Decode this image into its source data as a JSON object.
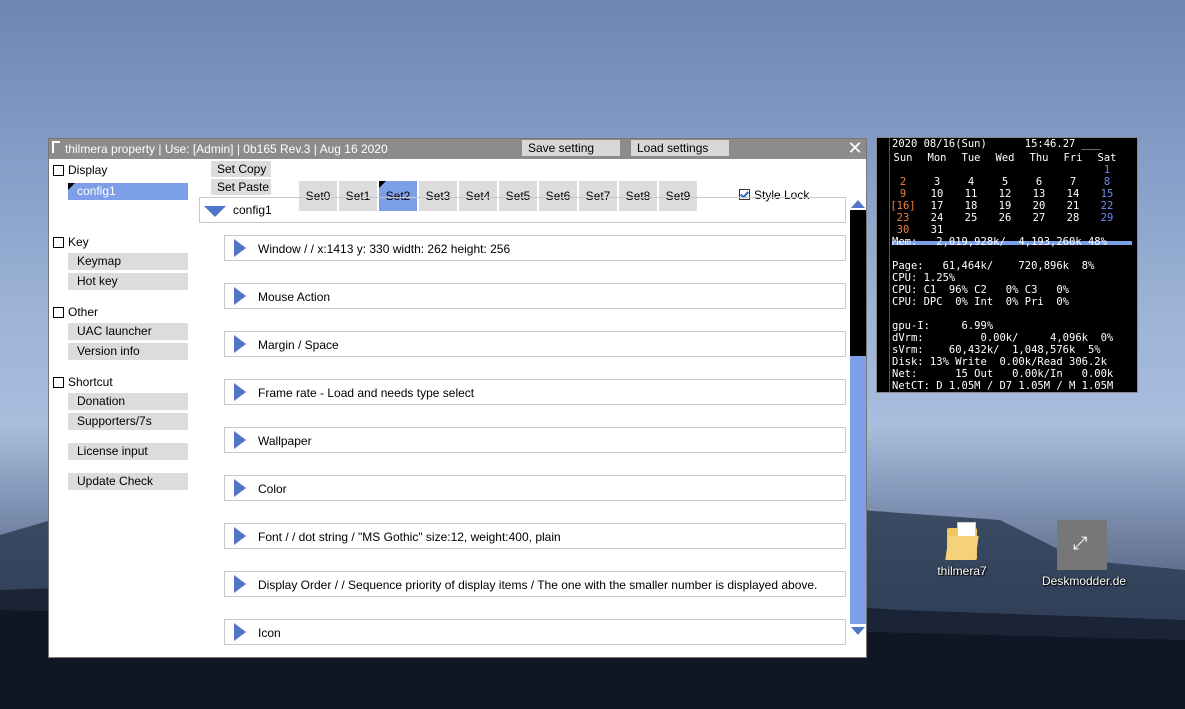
{
  "window": {
    "title": "thilmera property | Use: [Admin] | 0b165 Rev.3 | Aug 16 2020",
    "save_label": "Save setting",
    "load_label": "Load settings",
    "close": "✕"
  },
  "sidebar": {
    "display": {
      "label": "Display",
      "items": [
        "config1"
      ]
    },
    "key": {
      "label": "Key",
      "items": [
        "Keymap",
        "Hot key"
      ]
    },
    "other": {
      "label": "Other",
      "items": [
        "UAC launcher",
        "Version info"
      ]
    },
    "shortcut": {
      "label": "Shortcut",
      "items": [
        "Donation",
        "Supporters/7s",
        "License input",
        "Update Check"
      ]
    }
  },
  "toolbar": {
    "set_copy": "Set Copy",
    "set_paste": "Set Paste",
    "tabs": [
      "Set0",
      "Set1",
      "Set2",
      "Set3",
      "Set4",
      "Set5",
      "Set6",
      "Set7",
      "Set8",
      "Set9"
    ],
    "selected_tab": "Set2",
    "style_lock": "Style Lock",
    "style_lock_checked": true
  },
  "config": {
    "header": "config1",
    "sections": [
      "Window / / x:1413 y: 330 width: 262 height: 256",
      "Mouse Action",
      "Margin / Space",
      "Frame rate - Load and needs type select",
      "Wallpaper",
      "Color",
      "Font / / dot string / \"MS Gothic\" size:12, weight:400, plain",
      "Display Order / / Sequence priority of display items / The one with the smaller number is displayed above.",
      "Icon"
    ]
  },
  "widget": {
    "header_date": "2020 08/16(Sun)",
    "header_time": "15:46.27",
    "header_tail": "___",
    "weekdays": [
      "Sun",
      "Mon",
      "Tue",
      "Wed",
      "Thu",
      "Fri",
      "Sat"
    ],
    "calendar": [
      [
        "",
        "",
        "",
        "",
        "",
        "",
        "1"
      ],
      [
        "2",
        "3",
        "4",
        "5",
        "6",
        "7",
        "8"
      ],
      [
        "9",
        "10",
        "11",
        "12",
        "13",
        "14",
        "15"
      ],
      [
        "[16]",
        "17",
        "18",
        "19",
        "20",
        "21",
        "22"
      ],
      [
        "23",
        "24",
        "25",
        "26",
        "27",
        "28",
        "29"
      ],
      [
        "30",
        "31",
        "",
        "",
        "",
        "",
        ""
      ]
    ],
    "mem": "Mem:   2,019,928k/  4,193,260k 48%",
    "page": "Page:   61,464k/    720,896k  8%",
    "cpu": "CPU: 1.25%",
    "cpu_c": "CPU: C1  96% C2   0% C3   0%",
    "cpu_dpc": "CPU: DPC  0% Int  0% Pri  0%",
    "gpu": "gpu-I:     6.99%",
    "dvrm": "dVrm:         0.00k/     4,096k  0%",
    "svrm": "sVrm:    60,432k/  1,048,576k  5%",
    "disk": "Disk: 13% Write  0.00k/Read 306.2k",
    "net": "Net:      15 Out   0.00k/In   0.00k",
    "netct": "NetCT: D 1.05M / D7 1.05M / M 1.05M",
    "side_label": "thilmera7",
    "colors": {
      "sunday": "#f08040",
      "saturday": "#6b8ff0",
      "today": "#f08040",
      "bar": "#7c9fe8"
    }
  },
  "desktop": {
    "icons": [
      {
        "label": "thilmera7",
        "icon": "folder-icon"
      },
      {
        "label": "Deskmodder.de",
        "icon": "shortcut-icon"
      }
    ]
  },
  "colors": {
    "accent": "#7c9fe8",
    "triangle": "#4d76c8",
    "titlebar": "#8c8c8c"
  }
}
